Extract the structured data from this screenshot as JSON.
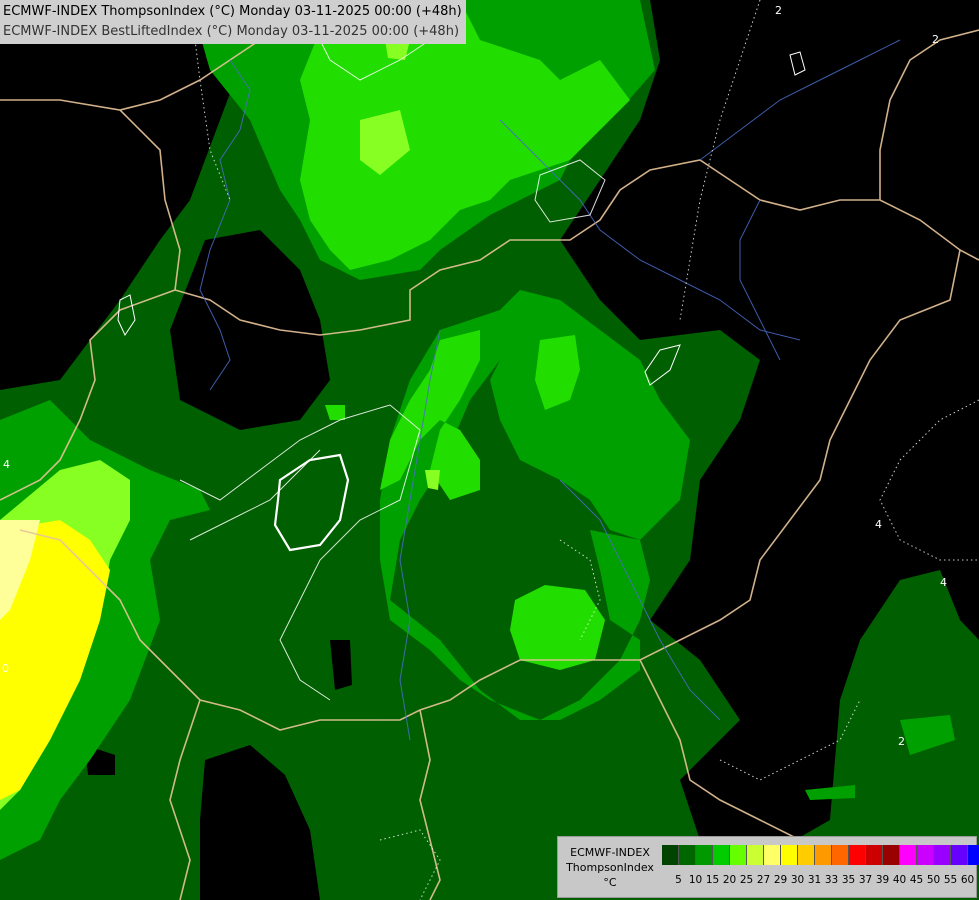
{
  "header": {
    "line1": "ECMWF-INDEX ThompsonIndex (°C) Monday 03-11-2025 00:00 (+48h)",
    "line2": "ECMWF-INDEX BestLiftedIndex (°C) Monday 03-11-2025 00:00 (+48h)"
  },
  "legend": {
    "model": "ECMWF-INDEX",
    "parameter": "ThompsonIndex",
    "unit": "°C",
    "ticks": [
      "5",
      "10",
      "15",
      "20",
      "25",
      "27",
      "29",
      "30",
      "31",
      "33",
      "35",
      "37",
      "39",
      "40",
      "45",
      "50",
      "55",
      "60"
    ],
    "colors": [
      "#000000",
      "#0a0a0a",
      "#101010",
      "#181818",
      "#004400",
      "#006600",
      "#009900",
      "#00cc00",
      "#66ff00",
      "#ccff33",
      "#ffff66",
      "#ffff00",
      "#ffcc00",
      "#ff9900",
      "#ff6600",
      "#ff0000",
      "#cc0000",
      "#990000",
      "#ff00ff",
      "#cc00ff",
      "#9900ff",
      "#6600ff",
      "#0000ff"
    ]
  },
  "map_labels": [
    "4",
    "2",
    "0",
    "2",
    "4",
    "4",
    "2"
  ]
}
